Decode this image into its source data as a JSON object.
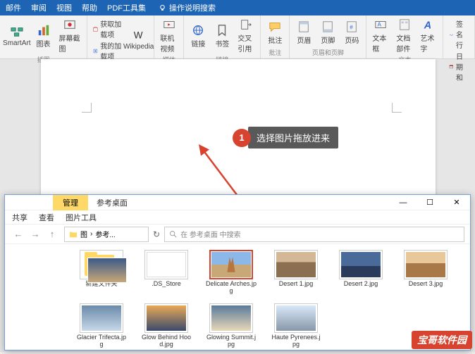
{
  "tabs": {
    "t1": "邮件",
    "t2": "审阅",
    "t3": "视图",
    "t4": "帮助",
    "t5": "PDF工具集",
    "help": "操作说明搜索"
  },
  "ribbon": {
    "g1": {
      "b1": "SmartArt",
      "b2": "图表",
      "b3": "屏幕截图",
      "lbl": "插图"
    },
    "g2": {
      "s1": "获取加载项",
      "s2": "我的加载项",
      "b1": "Wikipedia",
      "lbl": "加载项"
    },
    "g3": {
      "b1": "联机视频",
      "lbl": "媒体"
    },
    "g4": {
      "b1": "链接",
      "b2": "书签",
      "b3": "交叉引用",
      "lbl": "链接"
    },
    "g5": {
      "b1": "批注",
      "lbl": "批注"
    },
    "g6": {
      "b1": "页眉",
      "b2": "页脚",
      "b3": "页码",
      "lbl": "页眉和页脚"
    },
    "g7": {
      "b1": "文本框",
      "b2": "文档部件",
      "b3": "艺术字",
      "lbl": "文本"
    },
    "g8": {
      "s1": "签名行",
      "s2": "日期和"
    }
  },
  "callout": {
    "num": "1",
    "txt": "选择图片拖放进来"
  },
  "explorer": {
    "tab": "管理",
    "title": "参考桌面",
    "menu": {
      "m1": "共享",
      "m2": "查看",
      "m3": "图片工具"
    },
    "path": {
      "p1": "图",
      "p2": "参考..."
    },
    "search": "在 参考桌面 中搜索",
    "files": {
      "f1": "新建文件夹",
      "f2": ".DS_Store",
      "f3": "Delicate Arches.jpg",
      "f4": "Desert 1.jpg",
      "f5": "Desert 2.jpg",
      "f6": "Desert 3.jpg",
      "f7": "Glacier Trifecta.jpg",
      "f8": "Glow Behind Hood.jpg",
      "f9": "Glowing Summit.jpg",
      "f10": "Haute Pyrenees.jpg"
    }
  },
  "wm": "宝哥软件园"
}
